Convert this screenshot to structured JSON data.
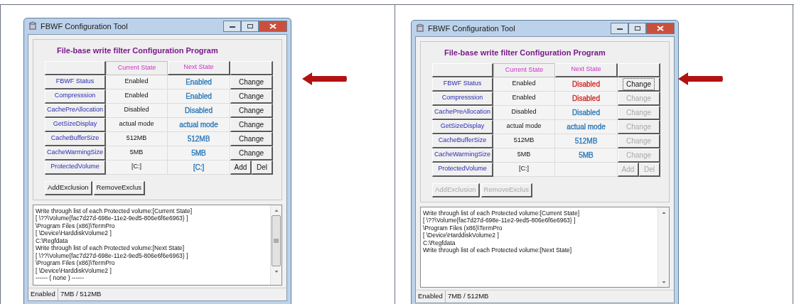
{
  "panels": [
    {
      "window": {
        "title": "FBWF Configuration Tool"
      },
      "heading": "File-base write filter Configuration Program",
      "columns": [
        "Current State",
        "Next State"
      ],
      "rows": [
        {
          "label": "FBWF Status",
          "current": "Enabled",
          "next": "Enabled",
          "color": "#2a78b8",
          "actions": [
            {
              "label": "Change",
              "disabled": false,
              "focused": false
            }
          ]
        },
        {
          "label": "Compresssion",
          "current": "Enabled",
          "next": "Enabled",
          "color": "#2a78b8",
          "actions": [
            {
              "label": "Change",
              "disabled": false,
              "focused": false
            }
          ]
        },
        {
          "label": "CachePreAllocation",
          "current": "Disabled",
          "next": "Disabled",
          "color": "#2a78b8",
          "actions": [
            {
              "label": "Change",
              "disabled": false,
              "focused": false
            }
          ]
        },
        {
          "label": "GetSizeDisplay",
          "current": "actual mode",
          "next": "actual mode",
          "color": "#2a78b8",
          "actions": [
            {
              "label": "Change",
              "disabled": false,
              "focused": false
            }
          ]
        },
        {
          "label": "CacheBufferSize",
          "current": "512MB",
          "next": "512MB",
          "color": "#2a78b8",
          "actions": [
            {
              "label": "Change",
              "disabled": false,
              "focused": false
            }
          ]
        },
        {
          "label": "CacheWarmingSize",
          "current": "5MB",
          "next": "5MB",
          "color": "#2a78b8",
          "actions": [
            {
              "label": "Change",
              "disabled": false,
              "focused": false
            }
          ]
        },
        {
          "label": "ProtectedVolume",
          "current": "[C:]",
          "next": "[C:]",
          "color": "#2a78b8",
          "actions": [
            {
              "label": "Add",
              "disabled": false,
              "focused": false
            },
            {
              "label": "Del",
              "disabled": false,
              "focused": false
            }
          ]
        }
      ],
      "exclusion_buttons": [
        {
          "label": "AddExclusion",
          "disabled": false
        },
        {
          "label": "RemoveExclus",
          "disabled": false
        }
      ],
      "log": [
        "Write through list of each Protected volume:[Current State]",
        "[ \\??\\Volume{fac7d27d-698e-11e2-9ed5-806e6f6e6963} ]",
        "\\Program Files (x86)\\TermPro",
        "[ \\Device\\HarddiskVolume2 ]",
        "C:\\Regfdata",
        "Write through list of each Protected volume:[Next State]",
        "[ \\??\\Volume{fac7d27d-698e-11e2-9ed5-806e6f6e6963} ]",
        "\\Program Files (x86)\\TermPro",
        "[ \\Device\\HarddiskVolume2 ]",
        "------ ( none ) ------"
      ],
      "status_bar": [
        "Enabled",
        "7MB / 512MB"
      ]
    },
    {
      "window": {
        "title": "FBWF Configuration Tool"
      },
      "heading": "File-base write filter Configuration Program",
      "columns": [
        "Current State",
        "Next State"
      ],
      "rows": [
        {
          "label": "FBWF Status",
          "current": "Enabled",
          "next": "Disabled",
          "color": "#d02828",
          "actions": [
            {
              "label": "Change",
              "disabled": false,
              "focused": true
            }
          ]
        },
        {
          "label": "Compresssion",
          "current": "Enabled",
          "next": "Disabled",
          "color": "#d02828",
          "actions": [
            {
              "label": "Change",
              "disabled": true,
              "focused": false
            }
          ]
        },
        {
          "label": "CachePreAllocation",
          "current": "Disabled",
          "next": "Disabled",
          "color": "#2a78b8",
          "actions": [
            {
              "label": "Change",
              "disabled": true,
              "focused": false
            }
          ]
        },
        {
          "label": "GetSizeDisplay",
          "current": "actual mode",
          "next": "actual mode",
          "color": "#2a78b8",
          "actions": [
            {
              "label": "Change",
              "disabled": true,
              "focused": false
            }
          ]
        },
        {
          "label": "CacheBufferSize",
          "current": "512MB",
          "next": "512MB",
          "color": "#2a78b8",
          "actions": [
            {
              "label": "Change",
              "disabled": true,
              "focused": false
            }
          ]
        },
        {
          "label": "CacheWarmingSize",
          "current": "5MB",
          "next": "5MB",
          "color": "#2a78b8",
          "actions": [
            {
              "label": "Change",
              "disabled": true,
              "focused": false
            }
          ]
        },
        {
          "label": "ProtectedVolume",
          "current": "[C:]",
          "actions": [
            {
              "label": "Add",
              "disabled": true,
              "focused": false
            },
            {
              "label": "Del",
              "disabled": true,
              "focused": false
            }
          ]
        }
      ],
      "exclusion_buttons": [
        {
          "label": "AddExclusion",
          "disabled": true
        },
        {
          "label": "RemoveExclus",
          "disabled": true
        }
      ],
      "log": [
        "Write through list of each Protected volume:[Current State]",
        "[ \\??\\Volume{fac7d27d-698e-11e2-9ed5-806e6f6e6963} ]",
        "\\Program Files (x86)\\TermPro",
        "[ \\Device\\HarddiskVolume2 ]",
        "C:\\Regfdata",
        "Write through list of each Protected volume:[Next State]"
      ],
      "status_bar": [
        "Enabled",
        "7MB / 512MB"
      ]
    }
  ]
}
